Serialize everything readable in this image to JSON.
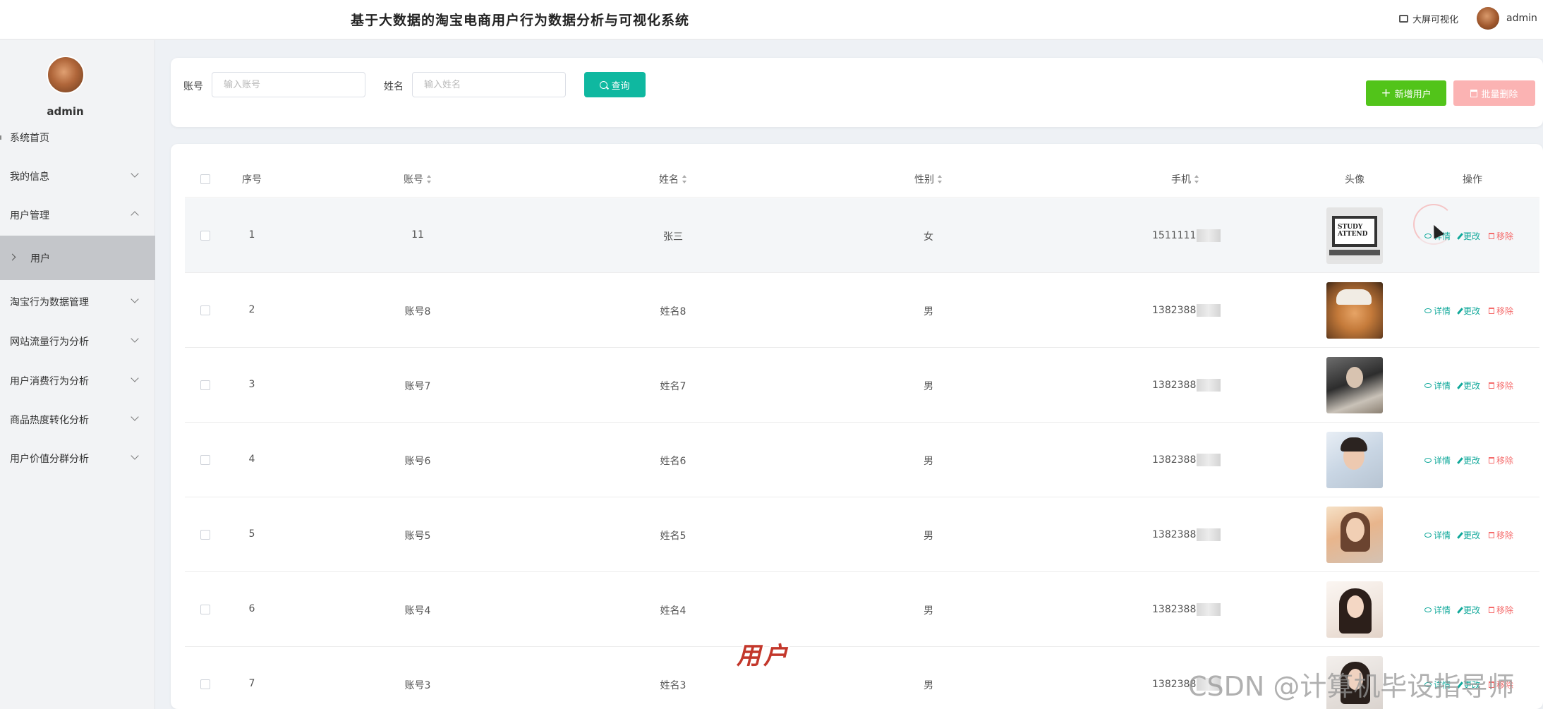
{
  "header": {
    "app_title": "基于大数据的淘宝电商用户行为数据分析与可视化系统",
    "bigscreen_label": "大屏可视化",
    "username": "admin"
  },
  "sidebar": {
    "username": "admin",
    "items": [
      {
        "label": "系统首页"
      },
      {
        "label": "我的信息"
      },
      {
        "label": "用户管理"
      },
      {
        "label": "用户"
      },
      {
        "label": "淘宝行为数据管理"
      },
      {
        "label": "网站流量行为分析"
      },
      {
        "label": "用户消费行为分析"
      },
      {
        "label": "商品热度转化分析"
      },
      {
        "label": "用户价值分群分析"
      }
    ]
  },
  "search": {
    "account_label": "账号",
    "account_placeholder": "输入账号",
    "account_value": "",
    "name_label": "姓名",
    "name_placeholder": "输入姓名",
    "name_value": "",
    "query_button": "查询",
    "add_button": "新增用户",
    "batch_delete_button": "批量删除"
  },
  "table": {
    "columns": {
      "index": "序号",
      "account": "账号",
      "name": "姓名",
      "gender": "性别",
      "phone": "手机",
      "avatar": "头像",
      "actions": "操作"
    },
    "action_labels": {
      "view": "详情",
      "edit": "更改",
      "delete": "移除"
    },
    "rows": [
      {
        "index": "1",
        "account": "11",
        "name": "张三",
        "gender": "女",
        "phone": "1511111"
      },
      {
        "index": "2",
        "account": "账号8",
        "name": "姓名8",
        "gender": "男",
        "phone": "1382388"
      },
      {
        "index": "3",
        "account": "账号7",
        "name": "姓名7",
        "gender": "男",
        "phone": "1382388"
      },
      {
        "index": "4",
        "account": "账号6",
        "name": "姓名6",
        "gender": "男",
        "phone": "1382388"
      },
      {
        "index": "5",
        "account": "账号5",
        "name": "姓名5",
        "gender": "男",
        "phone": "1382388"
      },
      {
        "index": "6",
        "account": "账号4",
        "name": "姓名4",
        "gender": "男",
        "phone": "1382388"
      },
      {
        "index": "7",
        "account": "账号3",
        "name": "姓名3",
        "gender": "男",
        "phone": "1382388"
      }
    ],
    "row1_image_text": "STUDY ATTEND"
  },
  "overlay": {
    "caption": "用户",
    "watermark": "CSDN @计算机毕设指导师"
  },
  "colors": {
    "accent": "#0fb8a0",
    "add_green": "#52c41a",
    "danger": "#f56c6c",
    "danger_light": "#fbb3b3"
  }
}
